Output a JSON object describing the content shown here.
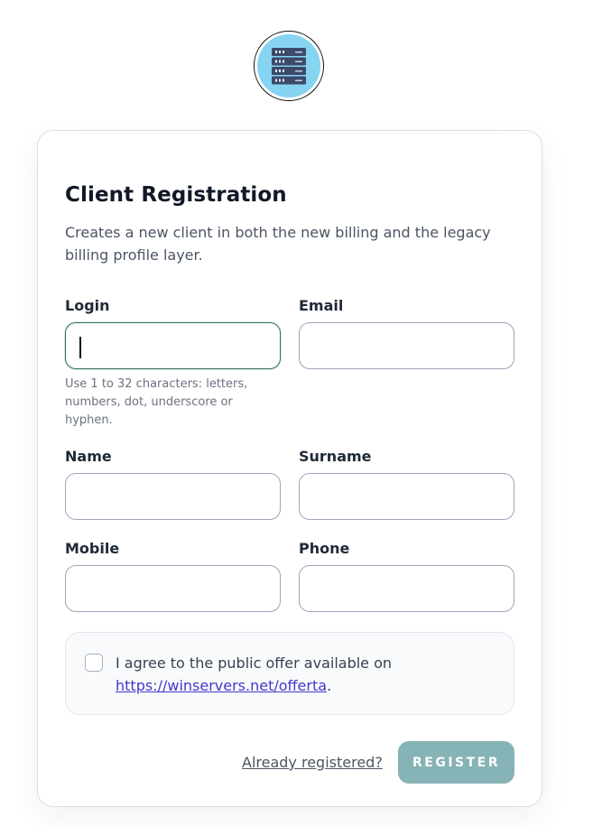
{
  "logo": {
    "icon": "server-rack-icon",
    "bg_color": "#87d3f2"
  },
  "form": {
    "title": "Client Registration",
    "subtitle": "Creates a new client in both the new billing and the legacy billing profile layer.",
    "fields": {
      "login": {
        "label": "Login",
        "value": "",
        "hint": "Use 1 to 32 characters: letters, numbers, dot, underscore or hyphen."
      },
      "email": {
        "label": "Email",
        "value": ""
      },
      "name": {
        "label": "Name",
        "value": ""
      },
      "surname": {
        "label": "Surname",
        "value": ""
      },
      "mobile": {
        "label": "Mobile",
        "value": ""
      },
      "phone": {
        "label": "Phone",
        "value": ""
      }
    },
    "agreement": {
      "checked": false,
      "text": "I agree to the public offer available on ",
      "link": "https://winservers.net/offerta",
      "suffix": "."
    },
    "already_registered": "Already registered?",
    "register_label": "Register"
  },
  "colors": {
    "accent_focus": "#2f6f68",
    "register_button": "#86b3b6",
    "link": "#4338ca"
  }
}
